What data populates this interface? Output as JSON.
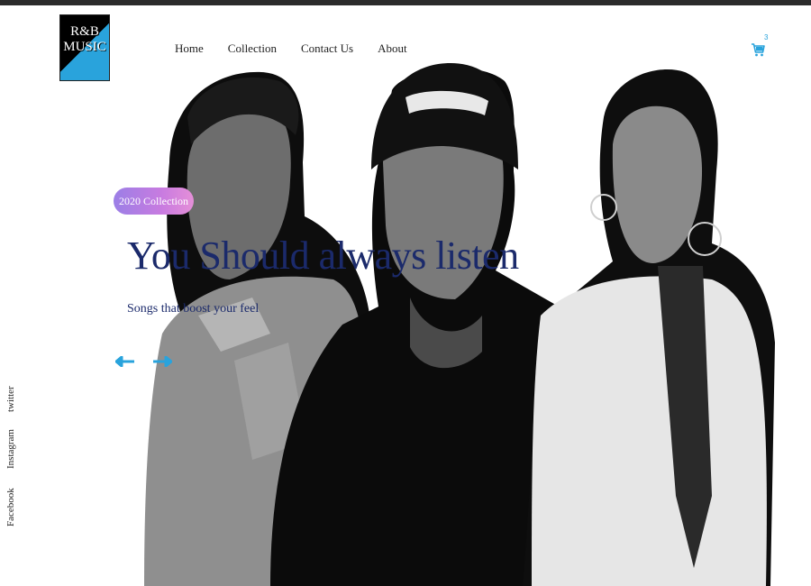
{
  "brand": {
    "logo_line1": "R&B",
    "logo_line2": "MUSIC",
    "accent": "#29a3dc"
  },
  "nav": {
    "items": [
      "Home",
      "Collection",
      "Contact Us",
      "About"
    ]
  },
  "cart": {
    "icon": "cart-icon",
    "count": "3"
  },
  "hero": {
    "badge": "2020 Collection",
    "headline": "You Should always listen",
    "subline": "Songs that boost your feel",
    "headline_color": "#1b2a6b"
  },
  "controls": {
    "prev_icon": "arrow-left-icon",
    "next_icon": "arrow-right-icon"
  },
  "social": {
    "items": [
      "twitter",
      "Instagram",
      "Facebook"
    ]
  }
}
